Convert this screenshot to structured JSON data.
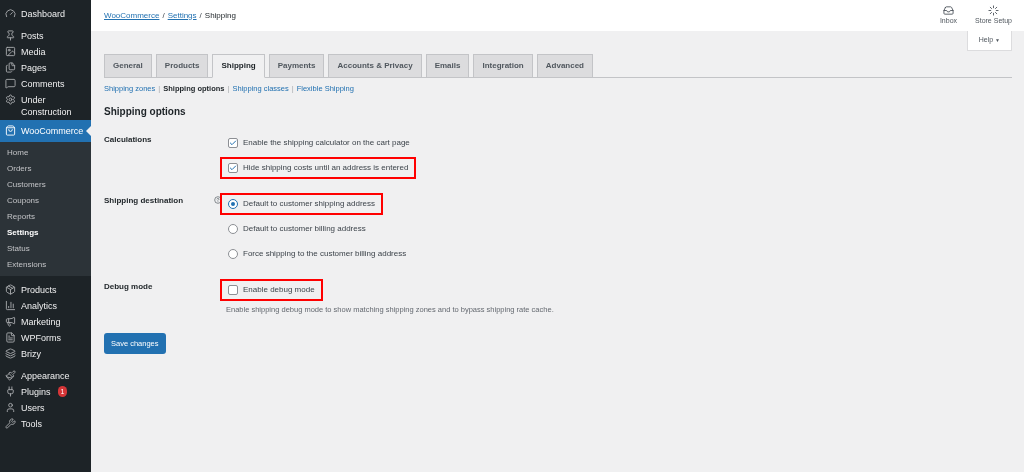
{
  "sidebar": {
    "items": [
      {
        "label": "Dashboard",
        "selected": false
      },
      {
        "label": "Posts",
        "selected": false
      },
      {
        "label": "Media",
        "selected": false
      },
      {
        "label": "Pages",
        "selected": false
      },
      {
        "label": "Comments",
        "selected": false
      },
      {
        "label": "Under Construction",
        "selected": false
      },
      {
        "label": "WooCommerce",
        "selected": true,
        "children": [
          {
            "label": "Home",
            "selected": false
          },
          {
            "label": "Orders",
            "selected": false
          },
          {
            "label": "Customers",
            "selected": false
          },
          {
            "label": "Coupons",
            "selected": false
          },
          {
            "label": "Reports",
            "selected": false
          },
          {
            "label": "Settings",
            "selected": true
          },
          {
            "label": "Status",
            "selected": false
          },
          {
            "label": "Extensions",
            "selected": false
          }
        ]
      },
      {
        "label": "Products",
        "selected": false
      },
      {
        "label": "Analytics",
        "selected": false
      },
      {
        "label": "Marketing",
        "selected": false
      },
      {
        "label": "WPForms",
        "selected": false
      },
      {
        "label": "Brizy",
        "selected": false
      },
      {
        "label": "Appearance",
        "selected": false
      },
      {
        "label": "Plugins",
        "selected": false,
        "badge": "1"
      },
      {
        "label": "Users",
        "selected": false
      },
      {
        "label": "Tools",
        "selected": false
      }
    ]
  },
  "breadcrumb": {
    "separator": "/",
    "items": [
      {
        "label": "WooCommerce",
        "link": true
      },
      {
        "label": "Settings",
        "link": true
      },
      {
        "label": "Shipping",
        "link": false
      }
    ]
  },
  "header_actions": [
    {
      "label": "Inbox"
    },
    {
      "label": "Store Setup"
    }
  ],
  "help_button": {
    "label": "Help",
    "caret": "▼"
  },
  "tabs": [
    {
      "label": "General",
      "selected": false
    },
    {
      "label": "Products",
      "selected": false
    },
    {
      "label": "Shipping",
      "selected": true
    },
    {
      "label": "Payments",
      "selected": false
    },
    {
      "label": "Accounts & Privacy",
      "selected": false
    },
    {
      "label": "Emails",
      "selected": false
    },
    {
      "label": "Integration",
      "selected": false
    },
    {
      "label": "Advanced",
      "selected": false
    }
  ],
  "subnav": {
    "separator": "|",
    "items": [
      {
        "label": "Shipping zones",
        "selected": false
      },
      {
        "label": "Shipping options",
        "selected": true
      },
      {
        "label": "Shipping classes",
        "selected": false
      },
      {
        "label": "Flexible Shipping",
        "selected": false
      }
    ]
  },
  "section_title": "Shipping options",
  "settings": [
    {
      "label": "Calculations",
      "help": false,
      "options": [
        {
          "kind": "checkbox",
          "label": "Enable the shipping calculator on the cart page",
          "checked": true,
          "highlighted": false
        },
        {
          "kind": "checkbox",
          "label": "Hide shipping costs until an address is entered",
          "checked": true,
          "highlighted": true
        }
      ]
    },
    {
      "label": "Shipping destination",
      "help": true,
      "options": [
        {
          "kind": "radio",
          "label": "Default to customer shipping address",
          "checked": true,
          "highlighted": true
        },
        {
          "kind": "radio",
          "label": "Default to customer billing address",
          "checked": false,
          "highlighted": false
        },
        {
          "kind": "radio",
          "label": "Force shipping to the customer billing address",
          "checked": false,
          "highlighted": false
        }
      ]
    },
    {
      "label": "Debug mode",
      "help": false,
      "options": [
        {
          "kind": "checkbox",
          "label": "Enable debug mode",
          "checked": false,
          "highlighted": true
        }
      ],
      "description": "Enable shipping debug mode to show matching shipping zones and to bypass shipping rate cache."
    }
  ],
  "save_button": "Save changes"
}
